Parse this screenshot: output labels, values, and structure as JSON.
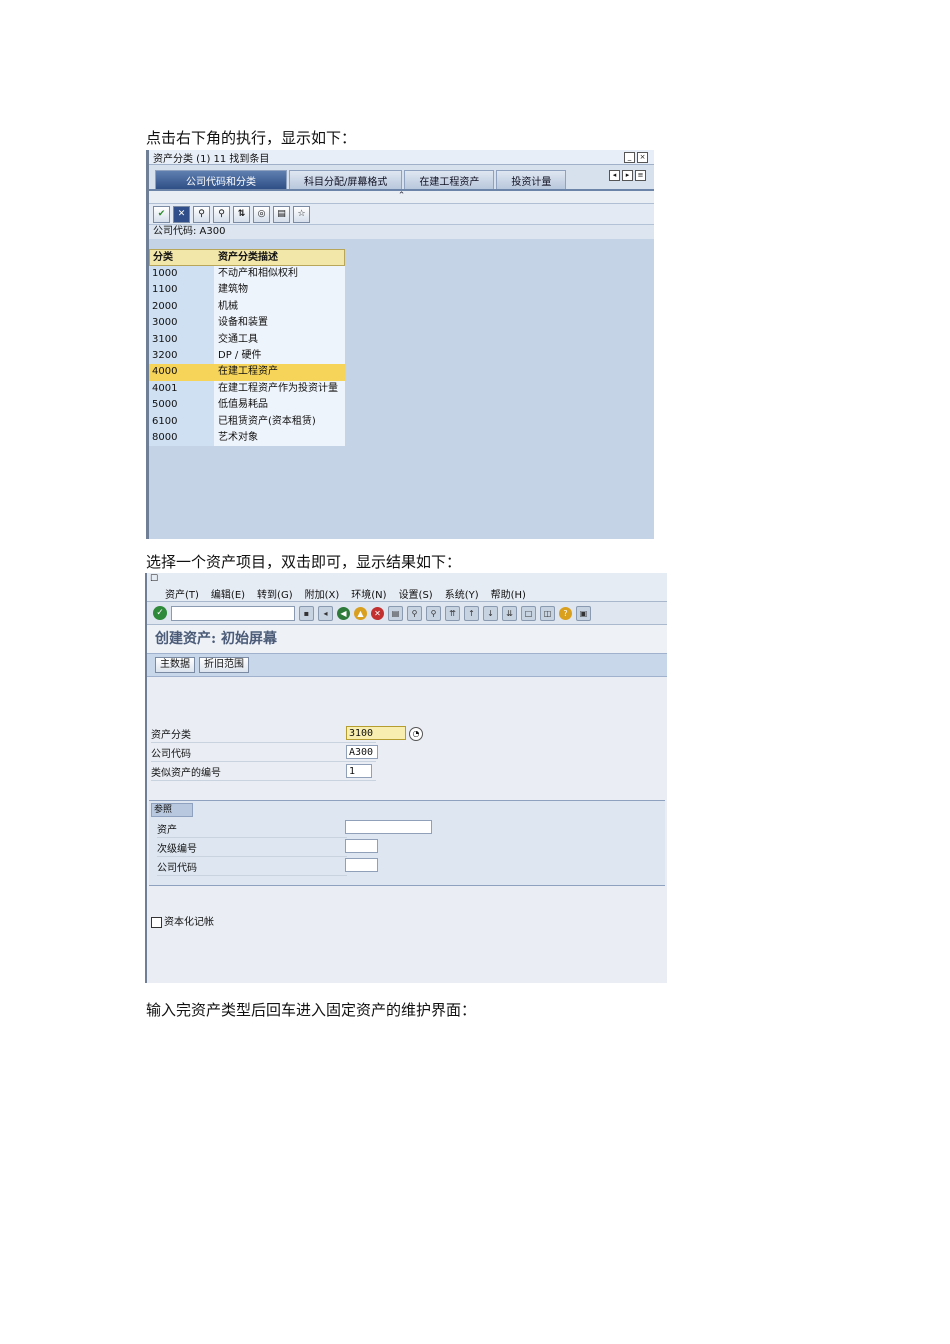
{
  "captions": {
    "c1": "点击右下角的执行，显示如下：",
    "c2": "选择一个资产项目，双击即可，显示结果如下：",
    "c3": "输入完资产类型后回车进入固定资产的维护界面："
  },
  "shot1": {
    "window_title": "资产分类 (1)   11 找到条目",
    "tabs": [
      "公司代码和分类",
      "科目分配/屏幕格式",
      "在建工程资产",
      "投资计量"
    ],
    "company_code_label": "公司代码: A300",
    "columns": [
      "分类",
      "资产分类描述"
    ],
    "rows": [
      {
        "code": "1000",
        "desc": "不动产和相似权利"
      },
      {
        "code": "1100",
        "desc": "建筑物"
      },
      {
        "code": "2000",
        "desc": "机械"
      },
      {
        "code": "3000",
        "desc": "设备和装置"
      },
      {
        "code": "3100",
        "desc": "交通工具"
      },
      {
        "code": "3200",
        "desc": "DP / 硬件"
      },
      {
        "code": "4000",
        "desc": "在建工程资产"
      },
      {
        "code": "4001",
        "desc": "在建工程资产作为投资计量"
      },
      {
        "code": "5000",
        "desc": "低值易耗品"
      },
      {
        "code": "6100",
        "desc": "已租赁资产(资本租赁)"
      },
      {
        "code": "8000",
        "desc": "艺术对象"
      }
    ],
    "selected_code": "4000"
  },
  "shot2": {
    "menus": [
      "资产(T)",
      "编辑(E)",
      "转到(G)",
      "附加(X)",
      "环境(N)",
      "设置(S)",
      "系统(Y)",
      "帮助(H)"
    ],
    "screen_title": "创建资产: 初始屏幕",
    "app_buttons": [
      "主数据",
      "折旧范围"
    ],
    "fields": {
      "asset_class_label": "资产分类",
      "asset_class_value": "3100",
      "company_code_label": "公司代码",
      "company_code_value": "A300",
      "similar_count_label": "类似资产的编号",
      "similar_count_value": "1"
    },
    "reference": {
      "title": "参照",
      "asset_label": "资产",
      "subnumber_label": "次级编号",
      "company_code_label": "公司代码"
    },
    "checkbox_label": "资本化记帐"
  }
}
